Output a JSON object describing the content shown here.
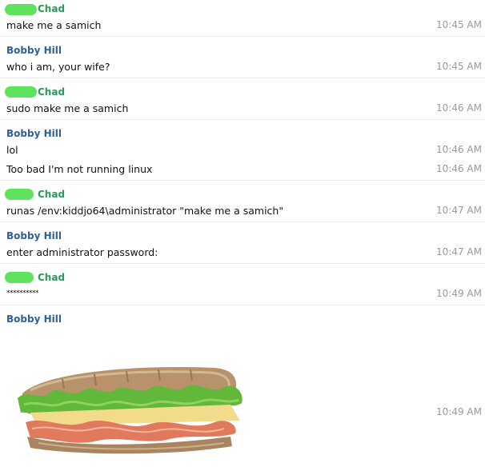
{
  "messages": [
    {
      "sender": "Chad",
      "text": "make me a samich",
      "time": "10:45 AM"
    },
    {
      "sender": "Bobby Hill",
      "text": "who i am, your wife?",
      "time": "10:45 AM"
    },
    {
      "sender": "Chad",
      "text": "sudo make me a samich",
      "time": "10:46 AM"
    },
    {
      "sender": "Bobby Hill",
      "text": "lol",
      "time": "10:46 AM"
    },
    {
      "sender": "",
      "text": "Too bad I'm not running linux",
      "time": "10:46 AM"
    },
    {
      "sender": "Chad",
      "text": "runas /env:kiddjo64\\administrator \"make me a samich\"",
      "time": "10:47 AM"
    },
    {
      "sender": "Bobby Hill",
      "text": "enter administrator password:",
      "time": "10:47 AM"
    },
    {
      "sender": "Chad",
      "text": "**********",
      "time": "10:49 AM"
    },
    {
      "sender": "Bobby Hill",
      "text": "",
      "time": "10:49 AM"
    }
  ],
  "image_alt": "sandwich-image",
  "colors": {
    "chad_name": "#2a9a57",
    "bobby_name": "#2f5f93",
    "redaction": "#5fe35f",
    "timestamp": "#9a9a9a",
    "divider": "#ebebeb"
  }
}
